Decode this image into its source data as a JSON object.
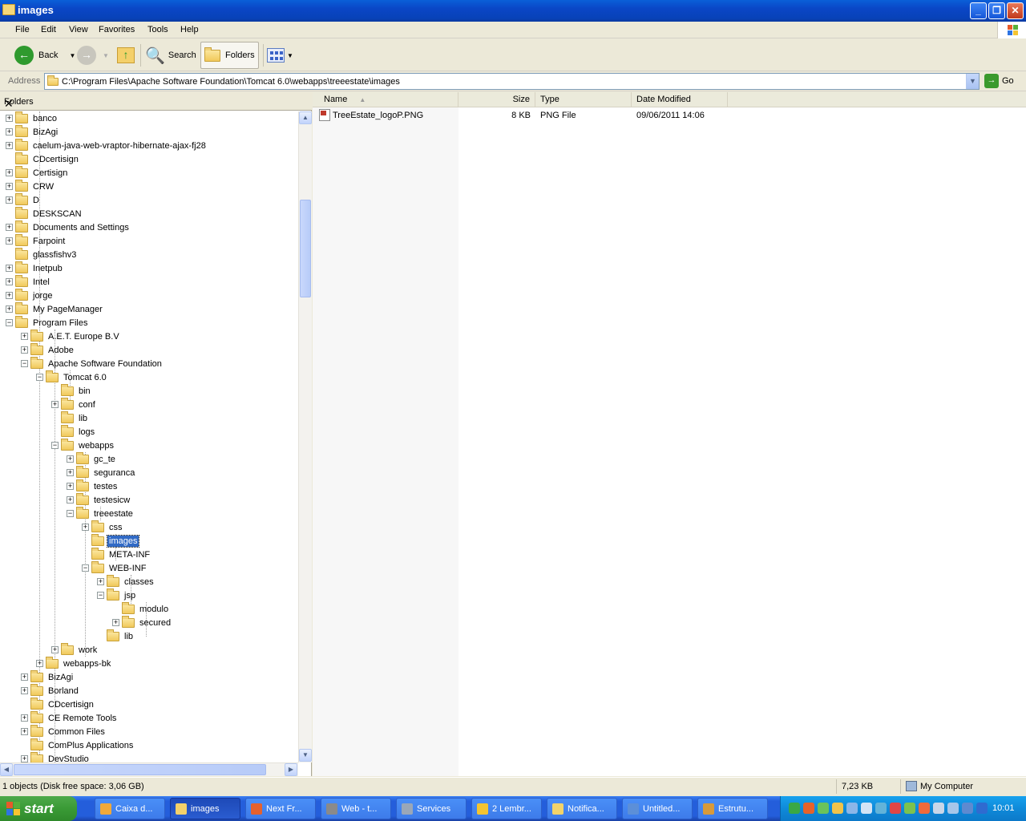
{
  "window": {
    "title": "images"
  },
  "menu": [
    "File",
    "Edit",
    "View",
    "Favorites",
    "Tools",
    "Help"
  ],
  "toolbar": {
    "back": "Back",
    "search": "Search",
    "folders": "Folders"
  },
  "address": {
    "label": "Address",
    "path": "C:\\Program Files\\Apache Software Foundation\\Tomcat 6.0\\webapps\\treeestate\\images",
    "go": "Go"
  },
  "folders_pane": {
    "title": "Folders"
  },
  "tree": [
    {
      "label": "banco",
      "expander": "+"
    },
    {
      "label": "BizAgi",
      "expander": "+"
    },
    {
      "label": "caelum-java-web-vraptor-hibernate-ajax-fj28",
      "expander": "+"
    },
    {
      "label": "CDcertisign",
      "expander": ""
    },
    {
      "label": "Certisign",
      "expander": "+"
    },
    {
      "label": "CRW",
      "expander": "+"
    },
    {
      "label": "D",
      "expander": "+"
    },
    {
      "label": "DESKSCAN",
      "expander": ""
    },
    {
      "label": "Documents and Settings",
      "expander": "+"
    },
    {
      "label": "Farpoint",
      "expander": "+"
    },
    {
      "label": "glassfishv3",
      "expander": ""
    },
    {
      "label": "Inetpub",
      "expander": "+"
    },
    {
      "label": "Intel",
      "expander": "+"
    },
    {
      "label": "jorge",
      "expander": "+"
    },
    {
      "label": "My PageManager",
      "expander": "+"
    },
    {
      "label": "Program Files",
      "expander": "-"
    },
    {
      "label": "A.E.T. Europe B.V",
      "expander": "+"
    },
    {
      "label": "Adobe",
      "expander": "+"
    },
    {
      "label": "Apache Software Foundation",
      "expander": "-"
    },
    {
      "label": "Tomcat 6.0",
      "expander": "-"
    },
    {
      "label": "bin",
      "expander": ""
    },
    {
      "label": "conf",
      "expander": "+"
    },
    {
      "label": "lib",
      "expander": ""
    },
    {
      "label": "logs",
      "expander": ""
    },
    {
      "label": "webapps",
      "expander": "-"
    },
    {
      "label": "gc_te",
      "expander": "+"
    },
    {
      "label": "seguranca",
      "expander": "+"
    },
    {
      "label": "testes",
      "expander": "+"
    },
    {
      "label": "testesicw",
      "expander": "+"
    },
    {
      "label": "treeestate",
      "expander": "-"
    },
    {
      "label": "css",
      "expander": "+"
    },
    {
      "label": "images",
      "expander": "",
      "selected": true
    },
    {
      "label": "META-INF",
      "expander": ""
    },
    {
      "label": "WEB-INF",
      "expander": "-"
    },
    {
      "label": "classes",
      "expander": "+"
    },
    {
      "label": "jsp",
      "expander": "-"
    },
    {
      "label": "modulo",
      "expander": ""
    },
    {
      "label": "secured",
      "expander": "+"
    },
    {
      "label": "lib",
      "expander": ""
    },
    {
      "label": "work",
      "expander": "+"
    },
    {
      "label": "webapps-bk",
      "expander": "+"
    },
    {
      "label": "BizAgi",
      "expander": "+"
    },
    {
      "label": "Borland",
      "expander": "+"
    },
    {
      "label": "CDcertisign",
      "expander": ""
    },
    {
      "label": "CE Remote Tools",
      "expander": "+"
    },
    {
      "label": "Common Files",
      "expander": "+"
    },
    {
      "label": "ComPlus Applications",
      "expander": ""
    },
    {
      "label": "DevStudio",
      "expander": "+"
    }
  ],
  "files": {
    "columns": [
      "Name",
      "Size",
      "Type",
      "Date Modified"
    ],
    "rows": [
      {
        "name": "TreeEstate_logoP.PNG",
        "size": "8 KB",
        "type": "PNG File",
        "modified": "09/06/2011 14:06"
      }
    ]
  },
  "status": {
    "left": "1 objects (Disk free space: 3,06 GB)",
    "size": "7,23 KB",
    "zone": "My Computer"
  },
  "taskbar": {
    "start": "start",
    "tasks": [
      {
        "label": "Caixa d...",
        "active": false
      },
      {
        "label": "images",
        "active": true
      },
      {
        "label": "Next Fr...",
        "active": false
      },
      {
        "label": "Web - t...",
        "active": false
      },
      {
        "label": "Services",
        "active": false
      },
      {
        "label": "2 Lembr...",
        "active": false
      },
      {
        "label": "Notifica...",
        "active": false
      },
      {
        "label": "Untitled...",
        "active": false
      },
      {
        "label": "Estrutu...",
        "active": false
      }
    ],
    "clock": "10:01"
  }
}
